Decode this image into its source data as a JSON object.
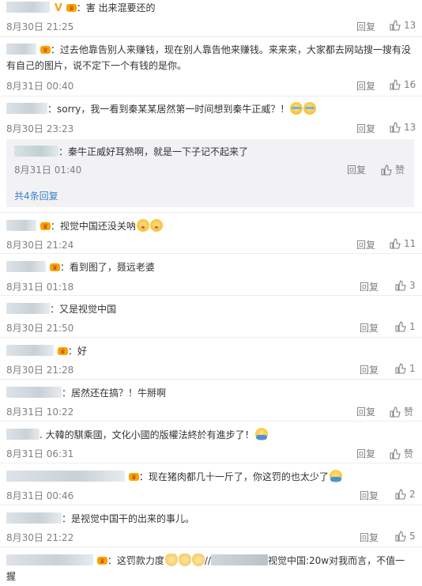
{
  "comments": [
    {
      "text": "害 出来混要还的",
      "time": "8月30日 21:25",
      "reply": "回复",
      "likes": "13"
    },
    {
      "text_line1": "过去他靠告别人来赚钱，现在别人靠告他来赚钱。来来来，大家都去网站搜一搜有没",
      "text_line2": "有自己的图片，说不定下一个有钱的是你。",
      "time": "8月31日 00:40",
      "reply": "回复",
      "likes": "16"
    },
    {
      "text": "sorry，我一看到秦某某居然第一时间想到秦牛正威？！",
      "time": "8月30日 23:23",
      "reply": "回复",
      "likes": "13",
      "sub": {
        "text": "秦牛正威好耳熟啊，就是一下子记不起来了",
        "time": "8月31日 01:40",
        "reply": "回复",
        "likes": "赞",
        "more": "共4条回复"
      }
    },
    {
      "text": "视觉中国还没关呐",
      "time": "8月30日 21:24",
      "reply": "回复",
      "likes": "11"
    },
    {
      "text": "看到图了，聂远老婆",
      "time": "8月31日 01:18",
      "reply": "回复",
      "likes": "3"
    },
    {
      "text": "又是视觉中国",
      "time": "8月30日 21:50",
      "reply": "回复",
      "likes": "1"
    },
    {
      "text": "好",
      "time": "8月30日 21:28",
      "reply": "回复",
      "likes": "1"
    },
    {
      "text": "居然还在搞？！牛掰啊",
      "time": "8月31日 10:22",
      "reply": "回复",
      "likes": "赞"
    },
    {
      "text": ". 大韓的騏乘國，文化小國的版權法終於有進步了！",
      "time": "8月31日 06:31",
      "reply": "回复",
      "likes": "赞"
    },
    {
      "text": "现在猪肉都几十一斤了，你这罚的也太少了",
      "time": "8月31日 00:46",
      "reply": "回复",
      "likes": "2"
    },
    {
      "text": "是视觉中国干的出来的事儿。",
      "time": "8月30日 21:22",
      "reply": "回复",
      "likes": "5"
    },
    {
      "text_a": "这罚款力度",
      "text_b": "视觉中国:20w对我而言，不值一",
      "text_line2": "握"
    }
  ],
  "icons": {
    "vip": "vip-crown-icon",
    "like": "thumbs-up-icon"
  },
  "colors": {
    "time": "#808080",
    "link": "#3a7ec7",
    "sub_bg": "#f2f2f5"
  }
}
